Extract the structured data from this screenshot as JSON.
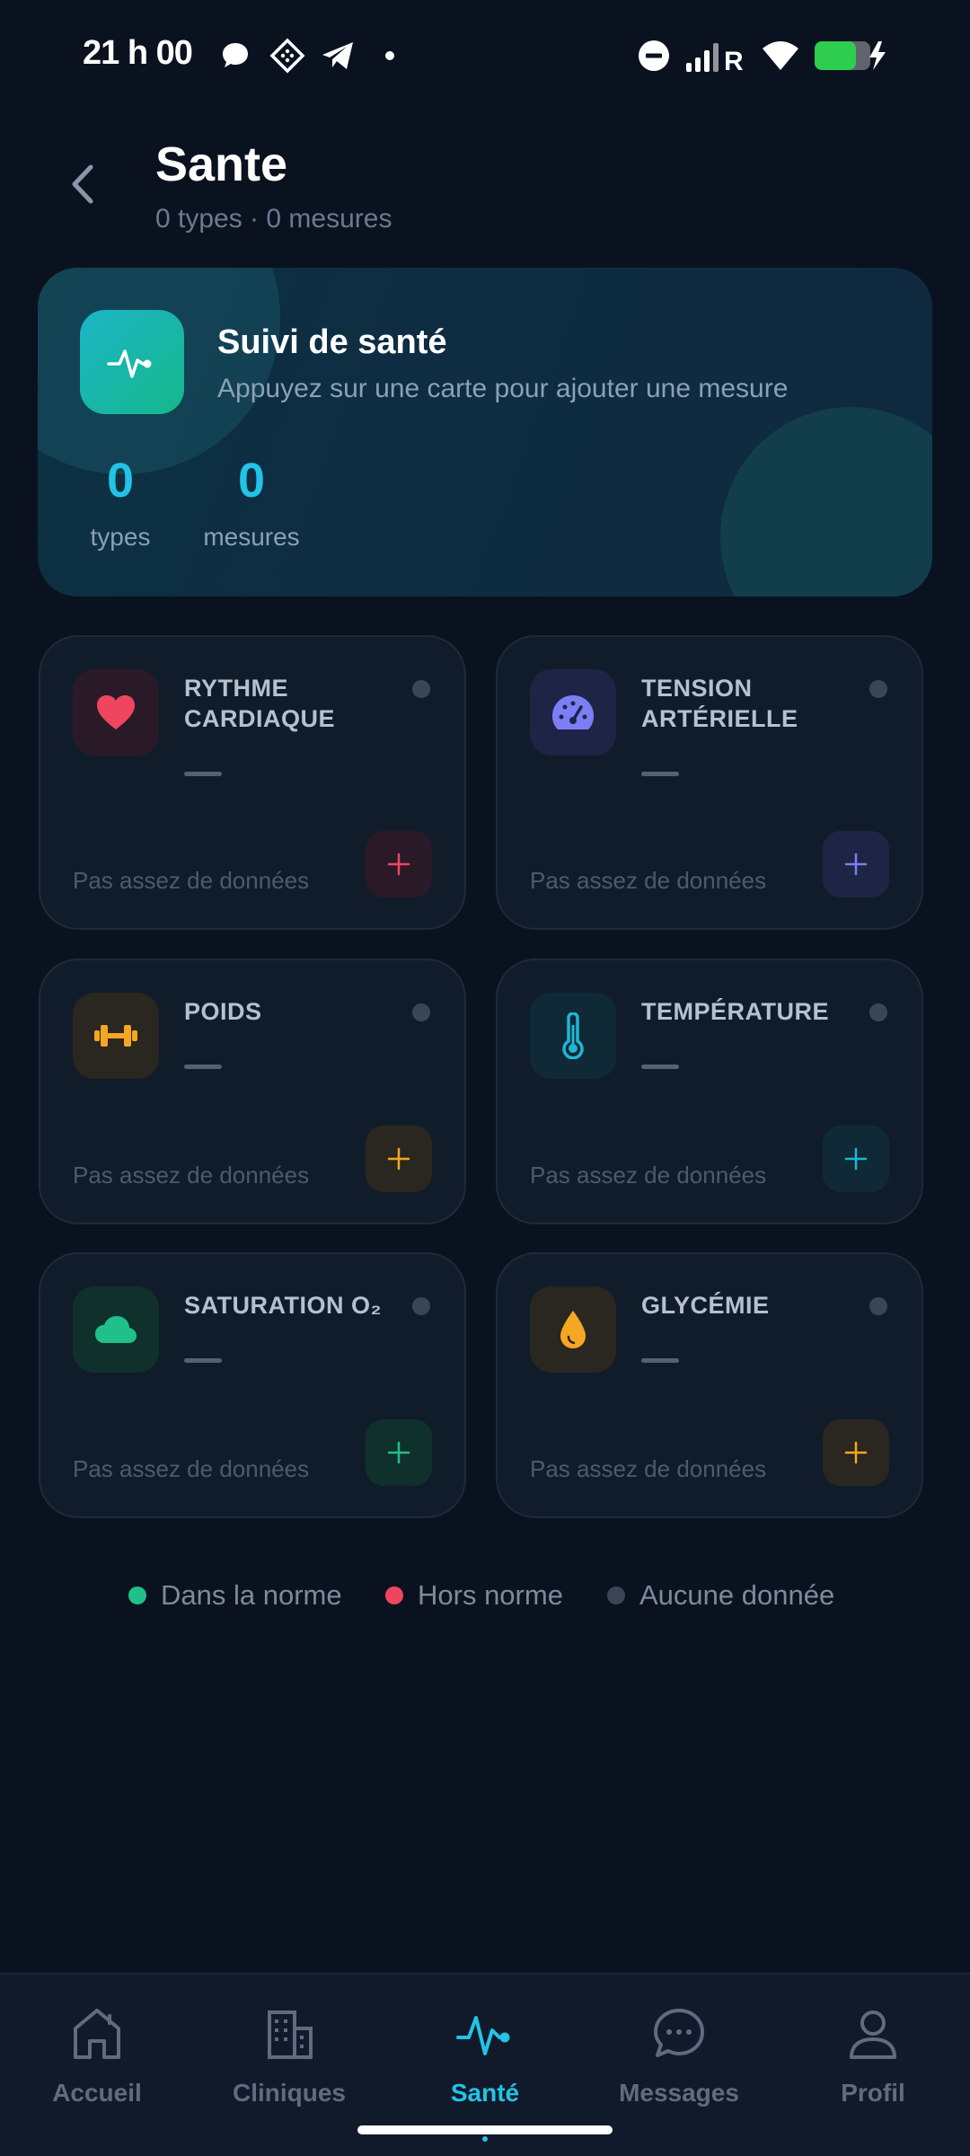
{
  "status_bar": {
    "time": "21 h 00",
    "battery_color": "#2ecc4f"
  },
  "header": {
    "title": "Sante",
    "subtitle": "0 types · 0 mesures"
  },
  "summary": {
    "title": "Suivi de santé",
    "description": "Appuyez sur une carte pour ajouter une mesure",
    "types_value": "0",
    "types_label": "types",
    "measures_value": "0",
    "measures_label": "mesures"
  },
  "metrics": [
    {
      "name": "RYTHME CARDIAQUE",
      "icon": "heart-icon",
      "value": "—",
      "footnote": "Pas assez de données",
      "accent": "#f0455f"
    },
    {
      "name": "TENSION ARTÉRIELLE",
      "icon": "gauge-icon",
      "value": "—",
      "footnote": "Pas assez de données",
      "accent": "#7b7ef5"
    },
    {
      "name": "POIDS",
      "icon": "dumbbell-icon",
      "value": "—",
      "footnote": "Pas assez de données",
      "accent": "#f5a623"
    },
    {
      "name": "TEMPÉRATURE",
      "icon": "thermometer-icon",
      "value": "—",
      "footnote": "Pas assez de données",
      "accent": "#1fb6d6"
    },
    {
      "name": "SATURATION O₂",
      "icon": "cloud-icon",
      "value": "—",
      "footnote": "Pas assez de données",
      "accent": "#20c08a"
    },
    {
      "name": "GLYCÉMIE",
      "icon": "drop-icon",
      "value": "—",
      "footnote": "Pas assez de données",
      "accent": "#f5a623"
    }
  ],
  "legend": [
    {
      "label": "Dans la norme",
      "color": "#20c08a"
    },
    {
      "label": "Hors norme",
      "color": "#f0455f"
    },
    {
      "label": "Aucune donnée",
      "color": "#3a4556"
    }
  ],
  "nav": [
    {
      "label": "Accueil",
      "icon": "home-icon"
    },
    {
      "label": "Cliniques",
      "icon": "building-icon"
    },
    {
      "label": "Santé",
      "icon": "pulse-icon",
      "active": true
    },
    {
      "label": "Messages",
      "icon": "chat-icon"
    },
    {
      "label": "Profil",
      "icon": "user-icon"
    }
  ],
  "colors": {
    "background": "#0a1220",
    "accent": "#22c3e6",
    "card": "#111c2b"
  }
}
